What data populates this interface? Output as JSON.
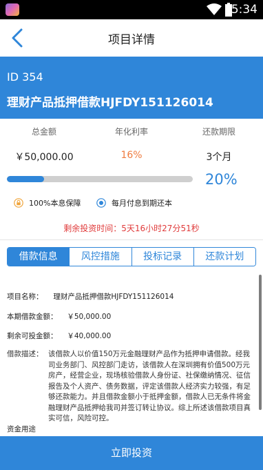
{
  "status_bar": {
    "time": "5:34"
  },
  "nav": {
    "title": "项目详情"
  },
  "project": {
    "id": "ID 354",
    "name": "理财产品抵押借款HJFDY151126014"
  },
  "stats": {
    "total": {
      "label": "总金额",
      "value": "￥50,000.00"
    },
    "rate": {
      "label": "年化利率",
      "value": "16%"
    },
    "term": {
      "label": "还款期限",
      "value": "3个月"
    }
  },
  "progress": {
    "fraction": 0.2,
    "percent_text": "20%"
  },
  "badges": {
    "guarantee": "100%本息保障",
    "repayment": "每月付息到期还本"
  },
  "remaining_time": "剩余投资时间：5天16小时27分51秒",
  "tabs": [
    {
      "label": "借款信息",
      "active": true
    },
    {
      "label": "风控措施",
      "active": false
    },
    {
      "label": "投标记录",
      "active": false
    },
    {
      "label": "还款计划",
      "active": false
    }
  ],
  "details": {
    "name": {
      "key": "项目名称：",
      "value": "理财产品抵押借款HJFDY151126014"
    },
    "amount": {
      "key": "本期借款金额：",
      "value": "￥50,000.00"
    },
    "investable": {
      "key": "剩余可投金额：",
      "value": "￥40,000.00"
    },
    "description": {
      "key": "借款描述：",
      "value": "该借款人以价值150万元金融理财产品作为抵押申请借款。经我司业务部门、风控部门走访，该借款人在深圳拥有价值500万元房产，经营企业，现场核验借款人身份证、社保缴纳情况、征信报告及个人资产、债务数据，评定该借款人经济实力较强，有足够还款能力。并且借款金额小于抵押金额，借款人已无条件将金融理财产品抵押给我司并签订转让协议。综上所述该借款项目真实可信，风险可控。"
    },
    "fund_use": {
      "key": "资金用途"
    }
  },
  "invest_button": {
    "label": "立即投资"
  },
  "colors": {
    "primary": "#2f86d9",
    "rate": "#ef7b3f",
    "warning": "#e03a3a"
  }
}
